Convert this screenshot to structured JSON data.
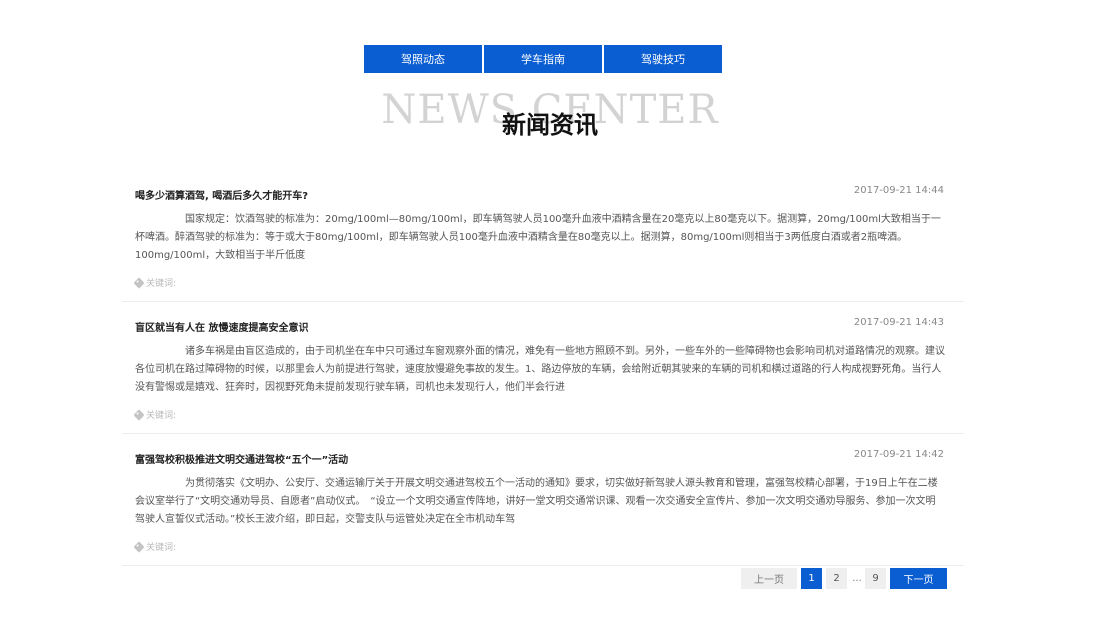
{
  "tabs": [
    {
      "label": "驾照动态"
    },
    {
      "label": "学车指南"
    },
    {
      "label": "驾驶技巧"
    }
  ],
  "heading": {
    "en": "NEWS CENTER",
    "cn": "新闻资讯"
  },
  "news": [
    {
      "title": "喝多少酒算酒驾, 喝酒后多久才能开车?",
      "date": "2017-09-21 14:44",
      "summary": "国家规定：饮酒驾驶的标准为：20mg/100ml—80mg/100ml，即车辆驾驶人员100毫升血液中酒精含量在20毫克以上80毫克以下。据测算，20mg/100ml大致相当于一杯啤酒。醉酒驾驶的标准为：等于或大于80mg/100ml，即车辆驾驶人员100毫升血液中酒精含量在80毫克以上。据测算，80mg/100ml则相当于3两低度白酒或者2瓶啤酒。100mg/100ml，大致相当于半斤低度",
      "keywords_label": "关键词:"
    },
    {
      "title": "盲区就当有人在 放慢速度提高安全意识",
      "date": "2017-09-21 14:43",
      "summary": "诸多车祸是由盲区造成的，由于司机坐在车中只可通过车窗观察外面的情况，难免有一些地方照顾不到。另外，一些车外的一些障碍物也会影响司机对道路情况的观察。建议各位司机在路过障碍物的时候，以那里会人为前提进行驾驶，速度放慢避免事故的发生。1、路边停放的车辆，会给附近朝其驶来的车辆的司机和横过道路的行人构成视野死角。当行人没有警惕或是嬉戏、狂奔时，因视野死角未提前发现行驶车辆，司机也未发现行人，他们半会行进",
      "keywords_label": "关键词:"
    },
    {
      "title": "富强驾校积极推进文明交通进驾校“五个一”活动",
      "date": "2017-09-21 14:42",
      "summary": "为贯彻落实《文明办、公安厅、交通运输厅关于开展文明交通进驾校五个一活动的通知》要求，切实做好新驾驶人源头教育和管理，富强驾校精心部署，于19日上午在二楼会议室举行了“文明交通劝导员、自愿者”启动仪式。　“设立一个文明交通宣传阵地，讲好一堂文明交通常识课、观看一次交通安全宣传片、参加一次文明交通劝导服务、参加一次文明驾驶人宣誓仪式活动。”校长王波介绍，即日起，交警支队与运管处决定在全市机动车驾",
      "keywords_label": "关键词:"
    }
  ],
  "pagination": {
    "prev": "上一页",
    "pages": [
      "1",
      "2"
    ],
    "ellipsis": "...",
    "last": "9",
    "next": "下一页",
    "current": "1"
  }
}
